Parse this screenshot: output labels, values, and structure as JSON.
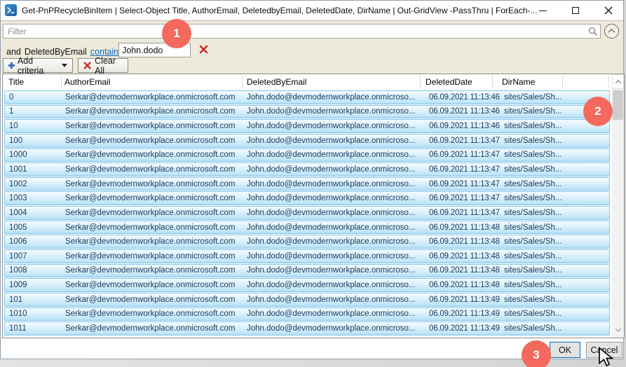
{
  "window": {
    "title": "Get-PnPRecycleBinItem | Select-Object Title, AuthorEmail, DeletedbyEmail, DeletedDate, DirName | Out-GridView -PassThru | ForEach-..."
  },
  "filter": {
    "placeholder": "Filter"
  },
  "criteria": {
    "conjunction": "and",
    "field": "DeletedByEmail",
    "operator": "contains",
    "value": "John.dodo"
  },
  "toolbar": {
    "add_criteria_label": "Add criteria",
    "clear_all_label": "Clear All"
  },
  "table": {
    "columns": [
      "Title",
      "AuthorEmail",
      "DeletedByEmail",
      "DeletedDate",
      "DirName"
    ],
    "rows": [
      {
        "title": "0",
        "author_email": "Serkar@devmodernworkplace.onmicrosoft.com",
        "deleted_by_email": "John.dodo@devmodernworkplace.onmicroso...",
        "deleted_date": "06.09.2021 11:13:46",
        "dir_name": "sites/Sales/Sh..."
      },
      {
        "title": "1",
        "author_email": "Serkar@devmodernworkplace.onmicrosoft.com",
        "deleted_by_email": "John.dodo@devmodernworkplace.onmicroso...",
        "deleted_date": "06.09.2021 11:13:46",
        "dir_name": "sites/Sales/Sh..."
      },
      {
        "title": "10",
        "author_email": "Serkar@devmodernworkplace.onmicrosoft.com",
        "deleted_by_email": "John.dodo@devmodernworkplace.onmicroso...",
        "deleted_date": "06.09.2021 11:13:46",
        "dir_name": "sites/Sales/Sh..."
      },
      {
        "title": "100",
        "author_email": "Serkar@devmodernworkplace.onmicrosoft.com",
        "deleted_by_email": "John.dodo@devmodernworkplace.onmicroso...",
        "deleted_date": "06.09.2021 11:13:47",
        "dir_name": "sites/Sales/Sh..."
      },
      {
        "title": "1000",
        "author_email": "Serkar@devmodernworkplace.onmicrosoft.com",
        "deleted_by_email": "John.dodo@devmodernworkplace.onmicroso...",
        "deleted_date": "06.09.2021 11:13:47",
        "dir_name": "sites/Sales/Sh..."
      },
      {
        "title": "1001",
        "author_email": "Serkar@devmodernworkplace.onmicrosoft.com",
        "deleted_by_email": "John.dodo@devmodernworkplace.onmicroso...",
        "deleted_date": "06.09.2021 11:13:47",
        "dir_name": "sites/Sales/Sh..."
      },
      {
        "title": "1002",
        "author_email": "Serkar@devmodernworkplace.onmicrosoft.com",
        "deleted_by_email": "John.dodo@devmodernworkplace.onmicroso...",
        "deleted_date": "06.09.2021 11:13:47",
        "dir_name": "sites/Sales/Sh..."
      },
      {
        "title": "1003",
        "author_email": "Serkar@devmodernworkplace.onmicrosoft.com",
        "deleted_by_email": "John.dodo@devmodernworkplace.onmicroso...",
        "deleted_date": "06.09.2021 11:13:47",
        "dir_name": "sites/Sales/Sh..."
      },
      {
        "title": "1004",
        "author_email": "Serkar@devmodernworkplace.onmicrosoft.com",
        "deleted_by_email": "John.dodo@devmodernworkplace.onmicroso...",
        "deleted_date": "06.09.2021 11:13:47",
        "dir_name": "sites/Sales/Sh..."
      },
      {
        "title": "1005",
        "author_email": "Serkar@devmodernworkplace.onmicrosoft.com",
        "deleted_by_email": "John.dodo@devmodernworkplace.onmicroso...",
        "deleted_date": "06.09.2021 11:13:48",
        "dir_name": "sites/Sales/Sh..."
      },
      {
        "title": "1006",
        "author_email": "Serkar@devmodernworkplace.onmicrosoft.com",
        "deleted_by_email": "John.dodo@devmodernworkplace.onmicroso...",
        "deleted_date": "06.09.2021 11:13:48",
        "dir_name": "sites/Sales/Sh..."
      },
      {
        "title": "1007",
        "author_email": "Serkar@devmodernworkplace.onmicrosoft.com",
        "deleted_by_email": "John.dodo@devmodernworkplace.onmicroso...",
        "deleted_date": "06.09.2021 11:13:48",
        "dir_name": "sites/Sales/Sh..."
      },
      {
        "title": "1008",
        "author_email": "Serkar@devmodernworkplace.onmicrosoft.com",
        "deleted_by_email": "John.dodo@devmodernworkplace.onmicroso...",
        "deleted_date": "06.09.2021 11:13:48",
        "dir_name": "sites/Sales/Sh..."
      },
      {
        "title": "1009",
        "author_email": "Serkar@devmodernworkplace.onmicrosoft.com",
        "deleted_by_email": "John.dodo@devmodernworkplace.onmicroso...",
        "deleted_date": "06.09.2021 11:13:48",
        "dir_name": "sites/Sales/Sh..."
      },
      {
        "title": "101",
        "author_email": "Serkar@devmodernworkplace.onmicrosoft.com",
        "deleted_by_email": "John.dodo@devmodernworkplace.onmicroso...",
        "deleted_date": "06.09.2021 11:13:49",
        "dir_name": "sites/Sales/Sh..."
      },
      {
        "title": "1010",
        "author_email": "Serkar@devmodernworkplace.onmicrosoft.com",
        "deleted_by_email": "John.dodo@devmodernworkplace.onmicroso...",
        "deleted_date": "06.09.2021 11:13:49",
        "dir_name": "sites/Sales/Sh..."
      },
      {
        "title": "1011",
        "author_email": "Serkar@devmodernworkplace.onmicrosoft.com",
        "deleted_by_email": "John.dodo@devmodernworkplace.onmicroso...",
        "deleted_date": "06.09.2021 11:13:49",
        "dir_name": "sites/Sales/Sh..."
      }
    ]
  },
  "buttons": {
    "ok": "OK",
    "cancel": "Cancel"
  },
  "annotations": [
    "1",
    "2",
    "3"
  ],
  "icons": {
    "app": "powershell-icon",
    "filter_right": "search-icon",
    "panel_toggle": "chevron-up-circle-icon",
    "add": "plus-icon",
    "clear": "red-x-icon",
    "remove_criteria": "red-x-icon",
    "scroll": "chevron-up-icon / chevron-down-icon",
    "pointer": "mouse-cursor-arrow"
  },
  "colors": {
    "panel_beige": "#edeadb",
    "row_selection": "#bce4f7",
    "row_border": "#85c6eb",
    "link_blue": "#0a66c2",
    "annotation_red": "#f3695e",
    "ok_focus_border": "#0067c0"
  }
}
